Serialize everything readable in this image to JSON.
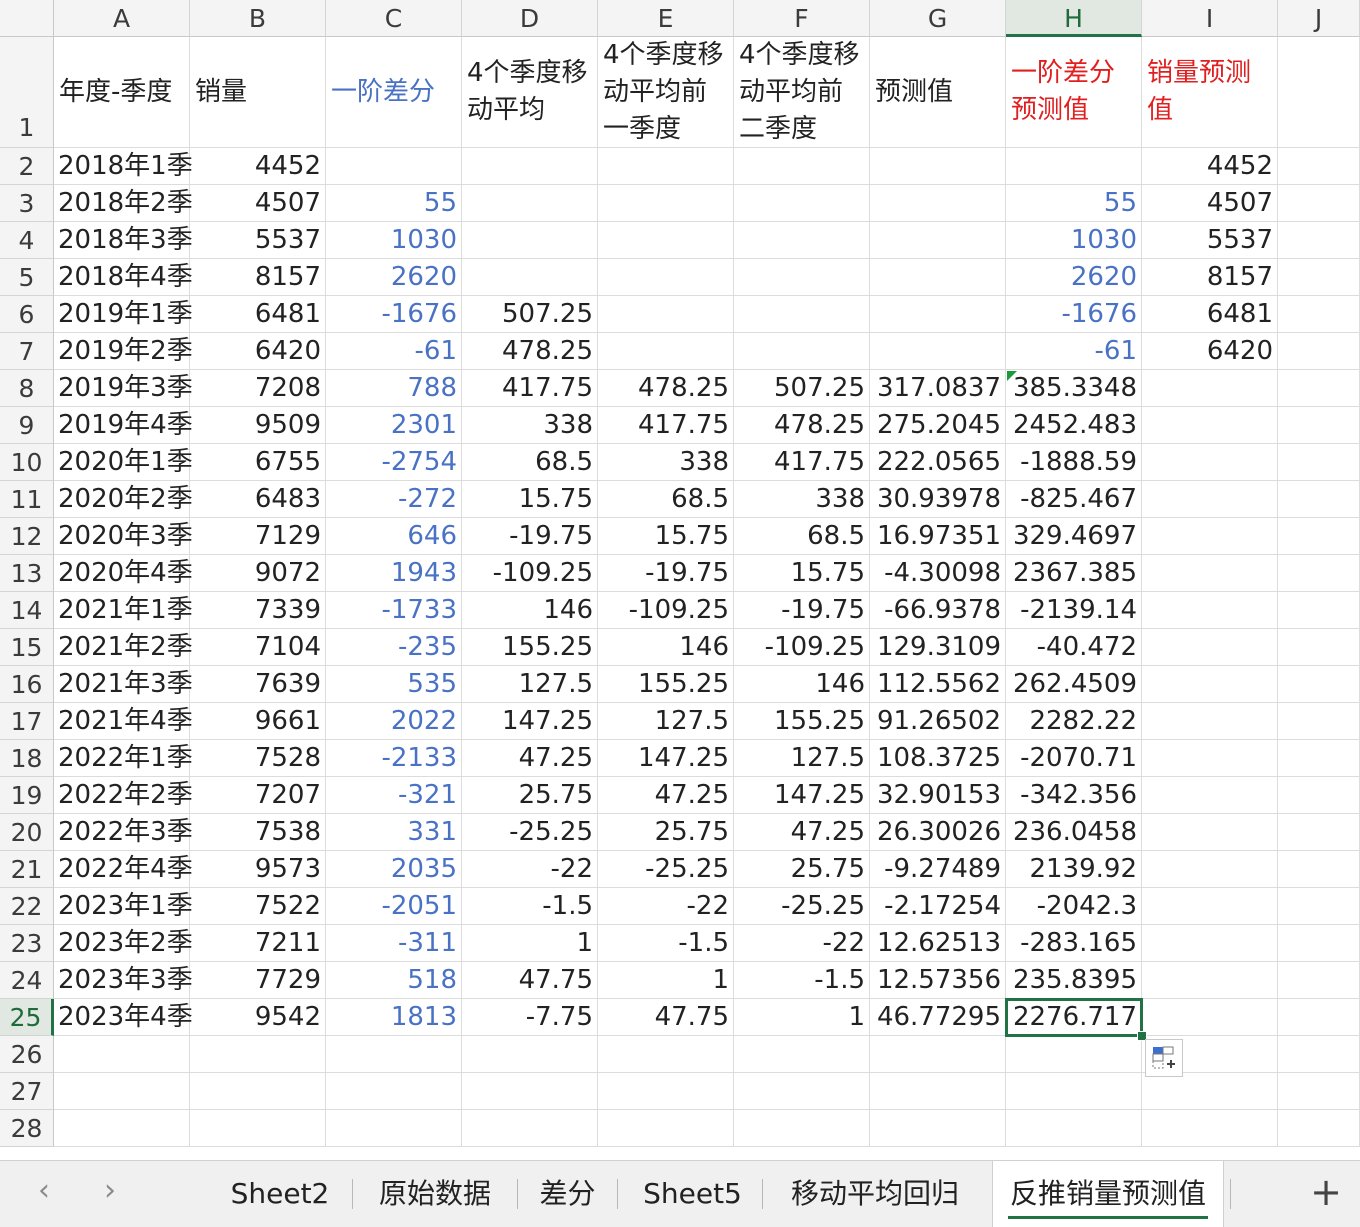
{
  "columns": [
    "A",
    "B",
    "C",
    "D",
    "E",
    "F",
    "G",
    "H",
    "I",
    "J"
  ],
  "selected_column": "H",
  "selected_row": "25",
  "header_row": {
    "row": "1",
    "A": "年度-季度",
    "B": "销量",
    "C": "一阶差分",
    "D": "4个季度移动平均",
    "E": "4个季度移动平均前一季度",
    "F": "4个季度移动平均前二季度",
    "G": "预测值",
    "H": "一阶差分预测值",
    "I": "销量预测值"
  },
  "rows": [
    {
      "n": "2",
      "A": "2018年1季",
      "B": "4452",
      "C": "",
      "D": "",
      "E": "",
      "F": "",
      "G": "",
      "H": "",
      "I": "4452"
    },
    {
      "n": "3",
      "A": "2018年2季",
      "B": "4507",
      "C": "55",
      "D": "",
      "E": "",
      "F": "",
      "G": "",
      "H": "55",
      "I": "4507"
    },
    {
      "n": "4",
      "A": "2018年3季",
      "B": "5537",
      "C": "1030",
      "D": "",
      "E": "",
      "F": "",
      "G": "",
      "H": "1030",
      "I": "5537"
    },
    {
      "n": "5",
      "A": "2018年4季",
      "B": "8157",
      "C": "2620",
      "D": "",
      "E": "",
      "F": "",
      "G": "",
      "H": "2620",
      "I": "8157"
    },
    {
      "n": "6",
      "A": "2019年1季",
      "B": "6481",
      "C": "-1676",
      "D": "507.25",
      "E": "",
      "F": "",
      "G": "",
      "H": "-1676",
      "I": "6481"
    },
    {
      "n": "7",
      "A": "2019年2季",
      "B": "6420",
      "C": "-61",
      "D": "478.25",
      "E": "",
      "F": "",
      "G": "",
      "H": "-61",
      "I": "6420"
    },
    {
      "n": "8",
      "A": "2019年3季",
      "B": "7208",
      "C": "788",
      "D": "417.75",
      "E": "478.25",
      "F": "507.25",
      "G": "317.0837",
      "H": "385.3348",
      "I": ""
    },
    {
      "n": "9",
      "A": "2019年4季",
      "B": "9509",
      "C": "2301",
      "D": "338",
      "E": "417.75",
      "F": "478.25",
      "G": "275.2045",
      "H": "2452.483",
      "I": ""
    },
    {
      "n": "10",
      "A": "2020年1季",
      "B": "6755",
      "C": "-2754",
      "D": "68.5",
      "E": "338",
      "F": "417.75",
      "G": "222.0565",
      "H": "-1888.59",
      "I": ""
    },
    {
      "n": "11",
      "A": "2020年2季",
      "B": "6483",
      "C": "-272",
      "D": "15.75",
      "E": "68.5",
      "F": "338",
      "G": "30.93978",
      "H": "-825.467",
      "I": ""
    },
    {
      "n": "12",
      "A": "2020年3季",
      "B": "7129",
      "C": "646",
      "D": "-19.75",
      "E": "15.75",
      "F": "68.5",
      "G": "16.97351",
      "H": "329.4697",
      "I": ""
    },
    {
      "n": "13",
      "A": "2020年4季",
      "B": "9072",
      "C": "1943",
      "D": "-109.25",
      "E": "-19.75",
      "F": "15.75",
      "G": "-4.30098",
      "H": "2367.385",
      "I": ""
    },
    {
      "n": "14",
      "A": "2021年1季",
      "B": "7339",
      "C": "-1733",
      "D": "146",
      "E": "-109.25",
      "F": "-19.75",
      "G": "-66.9378",
      "H": "-2139.14",
      "I": ""
    },
    {
      "n": "15",
      "A": "2021年2季",
      "B": "7104",
      "C": "-235",
      "D": "155.25",
      "E": "146",
      "F": "-109.25",
      "G": "129.3109",
      "H": "-40.472",
      "I": ""
    },
    {
      "n": "16",
      "A": "2021年3季",
      "B": "7639",
      "C": "535",
      "D": "127.5",
      "E": "155.25",
      "F": "146",
      "G": "112.5562",
      "H": "262.4509",
      "I": ""
    },
    {
      "n": "17",
      "A": "2021年4季",
      "B": "9661",
      "C": "2022",
      "D": "147.25",
      "E": "127.5",
      "F": "155.25",
      "G": "91.26502",
      "H": "2282.22",
      "I": ""
    },
    {
      "n": "18",
      "A": "2022年1季",
      "B": "7528",
      "C": "-2133",
      "D": "47.25",
      "E": "147.25",
      "F": "127.5",
      "G": "108.3725",
      "H": "-2070.71",
      "I": ""
    },
    {
      "n": "19",
      "A": "2022年2季",
      "B": "7207",
      "C": "-321",
      "D": "25.75",
      "E": "47.25",
      "F": "147.25",
      "G": "32.90153",
      "H": "-342.356",
      "I": ""
    },
    {
      "n": "20",
      "A": "2022年3季",
      "B": "7538",
      "C": "331",
      "D": "-25.25",
      "E": "25.75",
      "F": "47.25",
      "G": "26.30026",
      "H": "236.0458",
      "I": ""
    },
    {
      "n": "21",
      "A": "2022年4季",
      "B": "9573",
      "C": "2035",
      "D": "-22",
      "E": "-25.25",
      "F": "25.75",
      "G": "-9.27489",
      "H": "2139.92",
      "I": ""
    },
    {
      "n": "22",
      "A": "2023年1季",
      "B": "7522",
      "C": "-2051",
      "D": "-1.5",
      "E": "-22",
      "F": "-25.25",
      "G": "-2.17254",
      "H": "-2042.3",
      "I": ""
    },
    {
      "n": "23",
      "A": "2023年2季",
      "B": "7211",
      "C": "-311",
      "D": "1",
      "E": "-1.5",
      "F": "-22",
      "G": "12.62513",
      "H": "-283.165",
      "I": ""
    },
    {
      "n": "24",
      "A": "2023年3季",
      "B": "7729",
      "C": "518",
      "D": "47.75",
      "E": "1",
      "F": "-1.5",
      "G": "12.57356",
      "H": "235.8395",
      "I": ""
    },
    {
      "n": "25",
      "A": "2023年4季",
      "B": "9542",
      "C": "1813",
      "D": "-7.75",
      "E": "47.75",
      "F": "1",
      "G": "46.77295",
      "H": "2276.717",
      "I": ""
    },
    {
      "n": "26",
      "A": "",
      "B": "",
      "C": "",
      "D": "",
      "E": "",
      "F": "",
      "G": "",
      "H": "",
      "I": ""
    },
    {
      "n": "27",
      "A": "",
      "B": "",
      "C": "",
      "D": "",
      "E": "",
      "F": "",
      "G": "",
      "H": "",
      "I": ""
    },
    {
      "n": "28",
      "A": "",
      "B": "",
      "C": "",
      "D": "",
      "E": "",
      "F": "",
      "G": "",
      "H": "",
      "I": ""
    }
  ],
  "blue_columns_rows": {
    "C": "all",
    "H": "3-7"
  },
  "colors": {
    "blue_text": "#4a72c4",
    "red_header": "#e02020",
    "accent_green": "#217346"
  },
  "sheet_tabs": [
    "Sheet2",
    "原始数据",
    "差分",
    "Sheet5",
    "移动平均回归",
    "反推销量预测值"
  ],
  "active_tab": "反推销量预测值",
  "nav": {
    "prev_icon": "chevron-left-icon",
    "next_icon": "chevron-right-icon",
    "add_sheet_label": "+"
  }
}
